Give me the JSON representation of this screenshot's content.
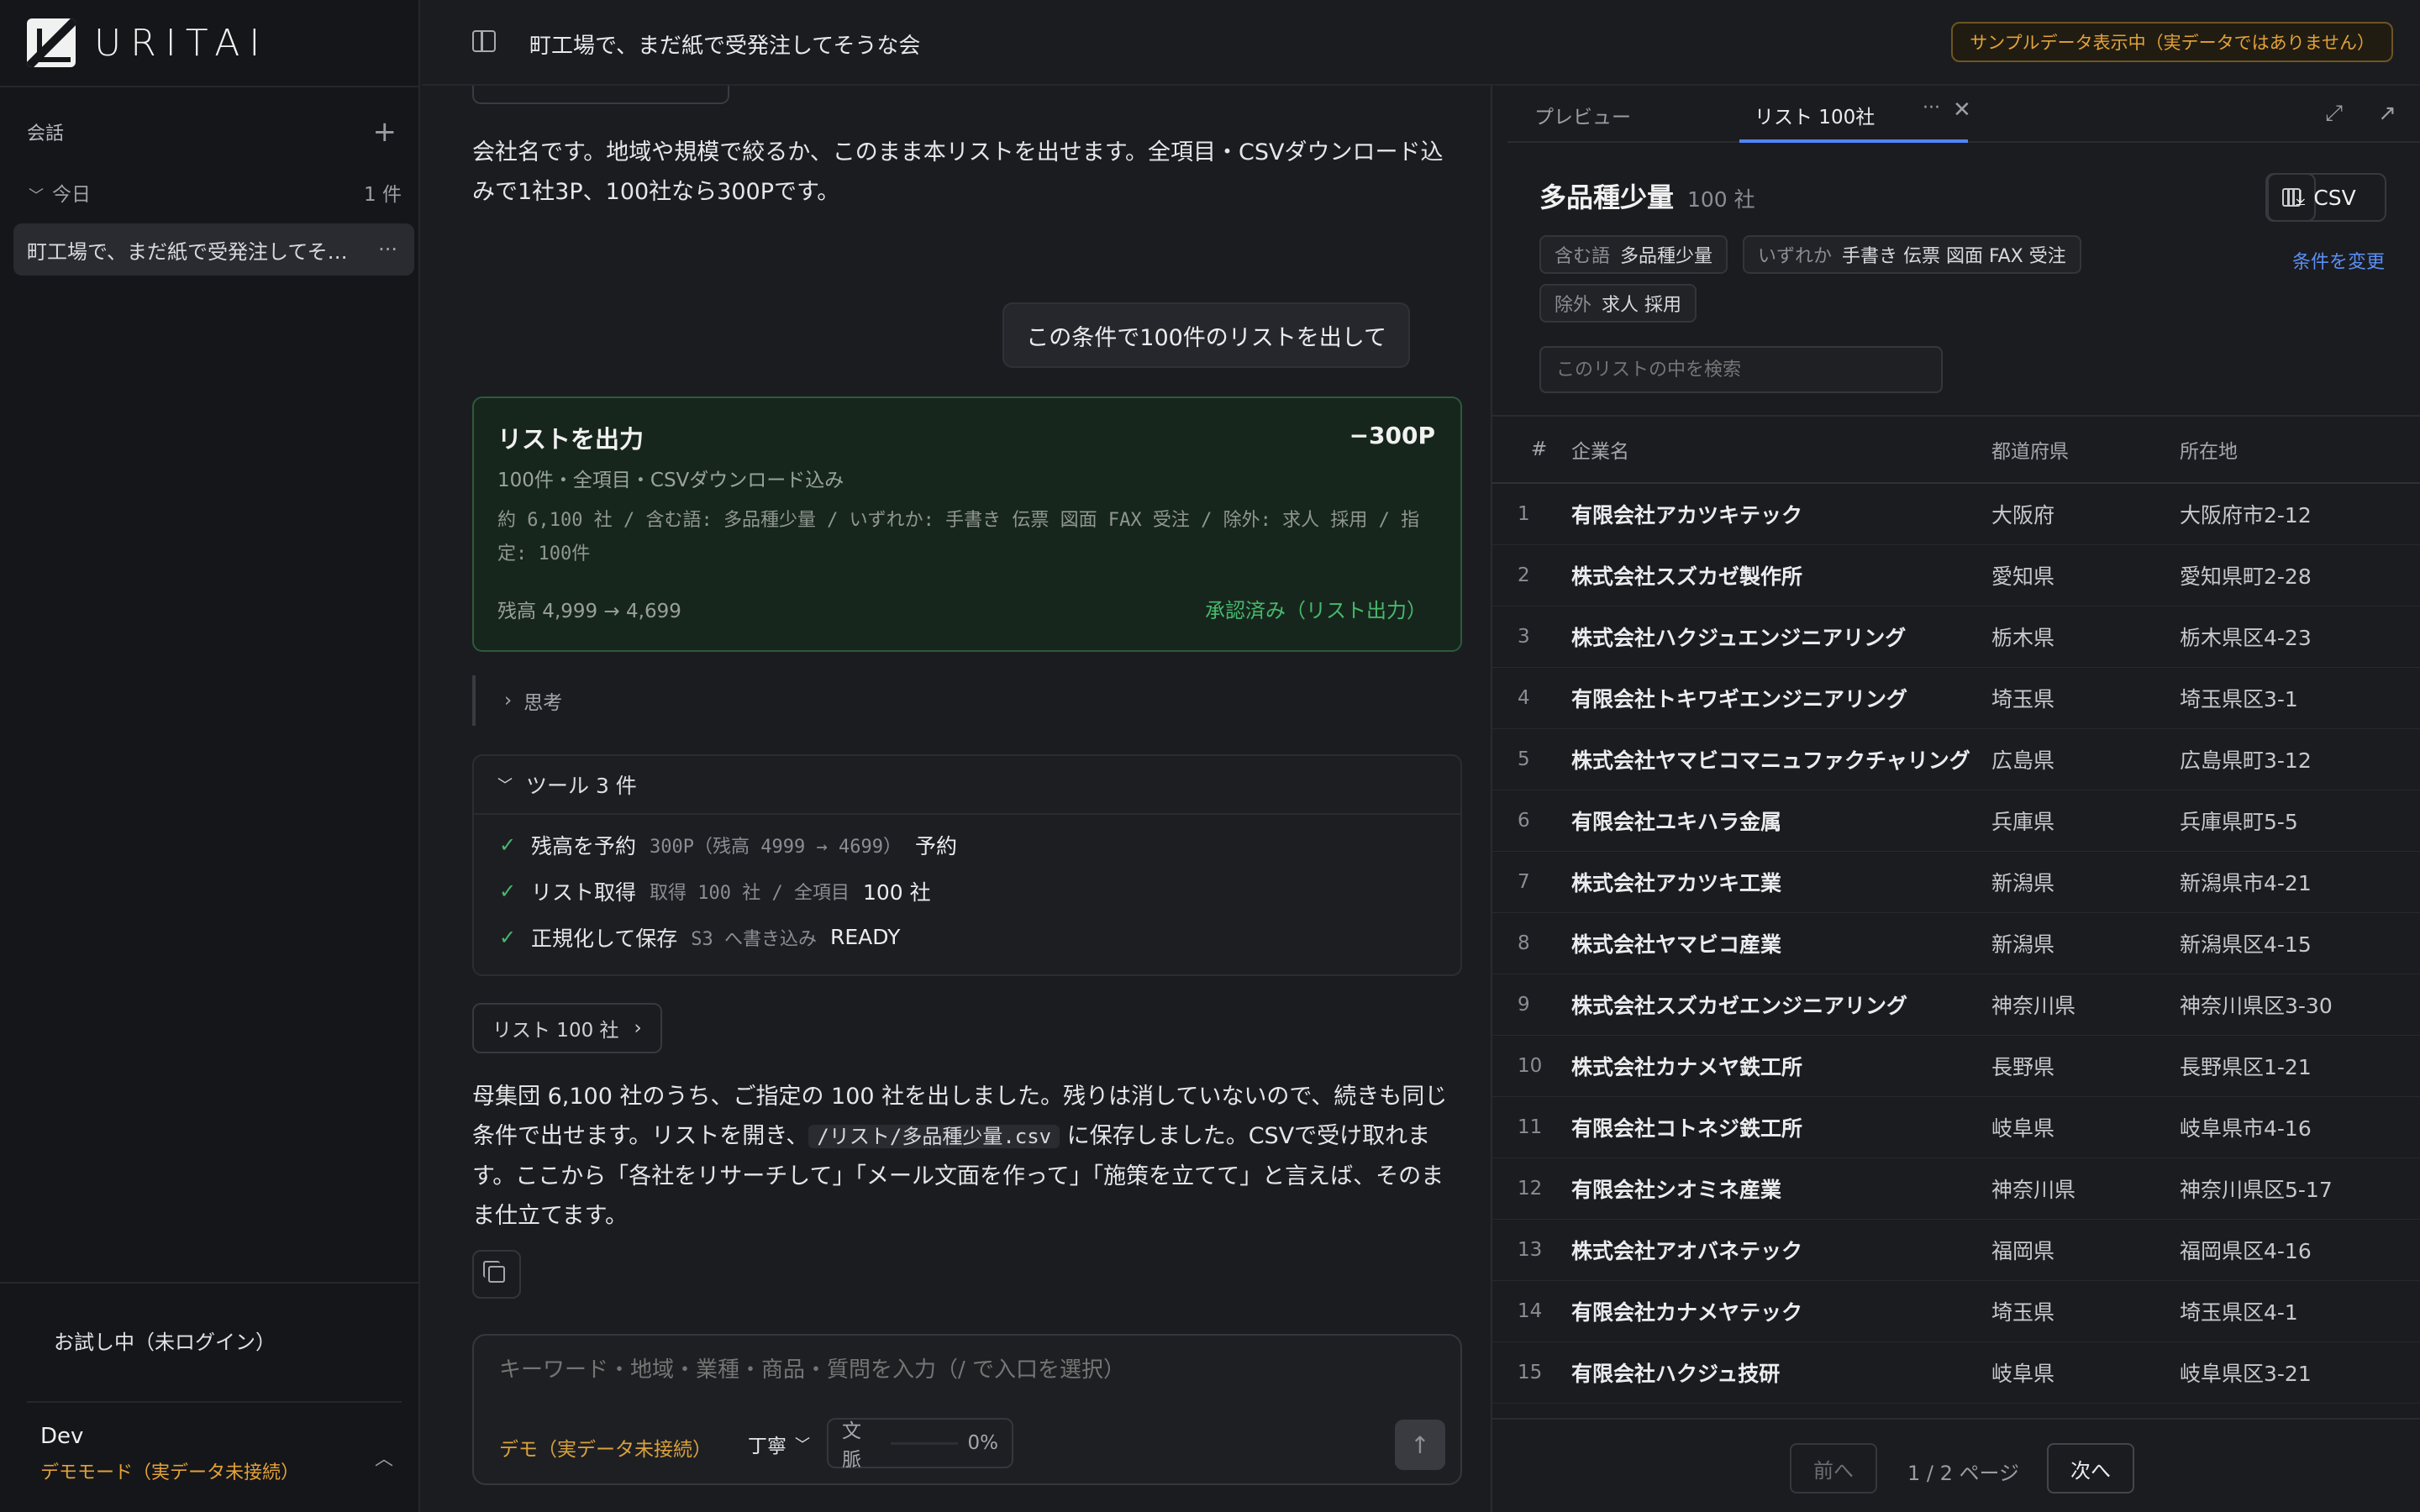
{
  "sidebar": {
    "logo_text": "URITAI",
    "section_label": "会話",
    "group_label": "今日",
    "group_count": "1 件",
    "conversation_title": "町工場で、まだ紙で受発注してそ…",
    "guest_label": "お試し中（未ログイン）",
    "user_name": "Dev",
    "user_mode": "デモモード（実データ未接続）"
  },
  "header": {
    "title": "町工場で、まだ紙で受発注してそうな会",
    "sample_badge": "サンプルデータ表示中（実データではありません）"
  },
  "chat": {
    "assistant_intro": "会社名です。地域や規模で絞るか、このまま本リストを出せます。全項目・CSVダウンロード込みで1社3P、100社なら300Pです。",
    "user_message": "この条件で100件のリストを出して",
    "output_card": {
      "title": "リストを出力",
      "cost": "−300P",
      "subtitle": "100件・全項目・CSVダウンロード込み",
      "conditions": "約 6,100 社 / 含む語: 多品種少量 / いずれか: 手書き 伝票 図面 FAX 受注 / 除外: 求人 採用 / 指定: 100件",
      "balance": "残高 4,999 → 4,699",
      "status": "承認済み（リスト出力）"
    },
    "thinking_label": "思考",
    "tools": {
      "header": "ツール 3 件",
      "items": [
        {
          "name": "残高を予約",
          "detail": "300P（残高 4999 → 4699）",
          "result": "予約"
        },
        {
          "name": "リスト取得",
          "detail": "取得 100 社 / 全項目",
          "result": "100 社"
        },
        {
          "name": "正規化して保存",
          "detail": "S3 へ書き込み",
          "result": "READY"
        }
      ]
    },
    "list_chip": "リスト 100 社",
    "result_part1": "母集団 6,100 社のうち、ご指定の 100 社を出しました。残りは消していないので、続きも同じ条件で出せます。リストを開き、",
    "result_code": "/リスト/多品種少量.csv",
    "result_part2": " に保存しました。CSVで受け取れます。ここから「各社をリサーチして」「メール文面を作って」「施策を立てて」と言えば、そのまま仕立てます。"
  },
  "composer": {
    "placeholder": "キーワード・地域・業種・商品・質問を入力（/ で入口を選択）",
    "demo_label": "デモ（実データ未接続）",
    "tone": "丁寧",
    "context_label": "文脈",
    "context_value": "0%"
  },
  "panel": {
    "tab_preview": "プレビュー",
    "tab_list": "リスト 100社",
    "list_name": "多品種少量",
    "list_count": "100 社",
    "csv_label": "CSV",
    "chip_include_key": "含む語",
    "chip_include_val": "多品種少量",
    "chip_any_key": "いずれか",
    "chip_any_val": "手書き 伝票 図面 FAX 受注",
    "chip_exclude_key": "除外",
    "chip_exclude_val": "求人 採用",
    "change_conditions": "条件を変更",
    "search_placeholder": "このリストの中を検索",
    "columns": {
      "num": "#",
      "name": "企業名",
      "pref": "都道府県",
      "loc": "所在地"
    },
    "rows": [
      {
        "num": "1",
        "name": "有限会社アカツキテック",
        "pref": "大阪府",
        "loc": "大阪府市2-12"
      },
      {
        "num": "2",
        "name": "株式会社スズカゼ製作所",
        "pref": "愛知県",
        "loc": "愛知県町2-28"
      },
      {
        "num": "3",
        "name": "株式会社ハクジュエンジニアリング",
        "pref": "栃木県",
        "loc": "栃木県区4-23"
      },
      {
        "num": "4",
        "name": "有限会社トキワギエンジニアリング",
        "pref": "埼玉県",
        "loc": "埼玉県区3-1"
      },
      {
        "num": "5",
        "name": "株式会社ヤマビコマニュファクチャリング",
        "pref": "広島県",
        "loc": "広島県町3-12"
      },
      {
        "num": "6",
        "name": "有限会社ユキハラ金属",
        "pref": "兵庫県",
        "loc": "兵庫県町5-5"
      },
      {
        "num": "7",
        "name": "株式会社アカツキ工業",
        "pref": "新潟県",
        "loc": "新潟県市4-21"
      },
      {
        "num": "8",
        "name": "株式会社ヤマビコ産業",
        "pref": "新潟県",
        "loc": "新潟県区4-15"
      },
      {
        "num": "9",
        "name": "株式会社スズカゼエンジニアリング",
        "pref": "神奈川県",
        "loc": "神奈川県区3-30"
      },
      {
        "num": "10",
        "name": "株式会社カナメヤ鉄工所",
        "pref": "長野県",
        "loc": "長野県区1-21"
      },
      {
        "num": "11",
        "name": "有限会社コトネジ鉄工所",
        "pref": "岐阜県",
        "loc": "岐阜県市4-16"
      },
      {
        "num": "12",
        "name": "有限会社シオミネ産業",
        "pref": "神奈川県",
        "loc": "神奈川県区5-17"
      },
      {
        "num": "13",
        "name": "株式会社アオバネテック",
        "pref": "福岡県",
        "loc": "福岡県区4-16"
      },
      {
        "num": "14",
        "name": "有限会社カナメヤテック",
        "pref": "埼玉県",
        "loc": "埼玉県区4-1"
      },
      {
        "num": "15",
        "name": "有限会社ハクジュ技研",
        "pref": "岐阜県",
        "loc": "岐阜県区3-21"
      }
    ],
    "prev": "前へ",
    "page_indicator": "1 / 2 ページ",
    "next": "次へ"
  },
  "colors": {
    "accent": "#4f86ff",
    "success": "#47b96c",
    "warning": "#e3a23a"
  }
}
